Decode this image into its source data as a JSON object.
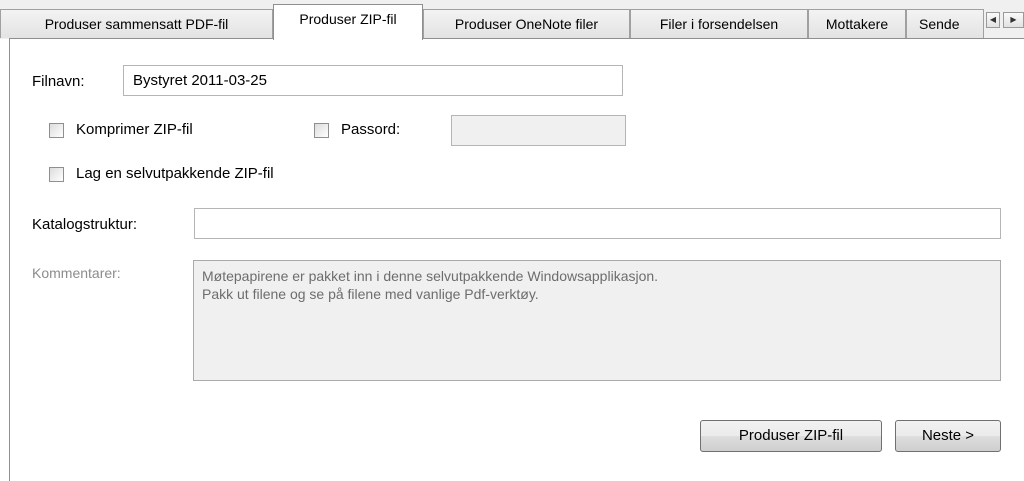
{
  "tabs": [
    {
      "label": "Produser sammensatt PDF-fil",
      "active": false
    },
    {
      "label": "Produser ZIP-fil",
      "active": true
    },
    {
      "label": "Produser OneNote filer",
      "active": false
    },
    {
      "label": "Filer i forsendelsen",
      "active": false
    },
    {
      "label": "Mottakere",
      "active": false
    },
    {
      "label": "Sende",
      "active": false
    }
  ],
  "tab_scroll": {
    "left": "◀",
    "right": "▶"
  },
  "form": {
    "filename_label": "Filnavn:",
    "filename_value": "Bystyret 2011-03-25",
    "compress_label": "Komprimer ZIP-fil",
    "compress_checked": false,
    "password_label": "Passord:",
    "password_value": "",
    "password_enabled": false,
    "selfextract_label": "Lag en selvutpakkende ZIP-fil",
    "selfextract_checked": false,
    "catalog_label": "Katalogstruktur:",
    "catalog_value": "",
    "comments_label": "Kommentarer:",
    "comments_line1": "Møtepapirene er pakket inn i denne selvutpakkende Windowsapplikasjon.",
    "comments_line2": "Pakk ut filene og se på filene med vanlige Pdf-verktøy.",
    "comments_enabled": false
  },
  "buttons": {
    "produce_zip": "Produser ZIP-fil",
    "next": "Neste >"
  }
}
